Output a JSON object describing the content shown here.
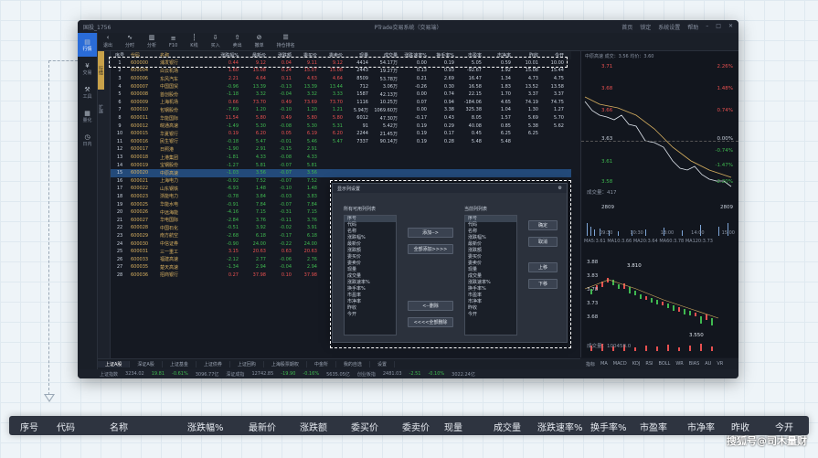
{
  "app": {
    "title": "PTrade交易系统（交易端）",
    "user": "国投_1756",
    "window_controls": [
      "首页",
      "锁定",
      "系统设置",
      "帮助"
    ]
  },
  "toolbar": {
    "items": [
      "退出",
      "分时",
      "分析",
      "F10",
      "K线",
      "买入",
      "卖出",
      "撤单",
      "持仓排名"
    ]
  },
  "leftnav": [
    "行情",
    "交易",
    "工具",
    "量化",
    "日内"
  ],
  "sidebar2": [
    "行情",
    "扩展"
  ],
  "grid": {
    "headers": [
      "序号",
      "代码",
      "名称",
      "涨跌幅%",
      "最新价",
      "涨跌额",
      "委买价",
      "委卖价",
      "现量",
      "成交量",
      "涨跌速率%",
      "换手率%",
      "市盈率",
      "市净率",
      "昨收",
      "今开"
    ],
    "rows": [
      [
        "1",
        "600000",
        "浦发银行",
        "0.44",
        "9.12",
        "0.04",
        "9.11",
        "9.12",
        "4414",
        "54.17万",
        "0.00",
        "0.19",
        "5.05",
        "0.59",
        "10.01",
        "10.00"
      ],
      [
        "2",
        "600004",
        "白云机场",
        "1.60",
        "15.08",
        "0.24",
        "15.07",
        "15.08",
        "2443",
        "19.27万",
        "0.13",
        "0.93",
        "-92.67",
        "1.92",
        "15.08",
        "15.44"
      ],
      [
        "3",
        "600006",
        "东风汽车",
        "2.21",
        "4.64",
        "0.11",
        "4.63",
        "4.64",
        "8509",
        "53.78万",
        "0.21",
        "2.69",
        "16.47",
        "1.34",
        "4.73",
        "4.75"
      ],
      [
        "4",
        "600007",
        "中国国贸",
        "-0.96",
        "13.39",
        "-0.13",
        "13.39",
        "13.44",
        "712",
        "3.06万",
        "-0.26",
        "0.30",
        "16.58",
        "1.83",
        "13.52",
        "13.58"
      ],
      [
        "5",
        "600008",
        "首创股份",
        "-1.18",
        "3.32",
        "-0.04",
        "3.32",
        "3.33",
        "1587",
        "42.13万",
        "0.00",
        "0.74",
        "22.15",
        "1.70",
        "3.37",
        "3.37"
      ],
      [
        "6",
        "600009",
        "上海机场",
        "0.66",
        "73.70",
        "0.49",
        "73.69",
        "73.70",
        "1116",
        "10.25万",
        "0.07",
        "0.94",
        "-184.06",
        "4.65",
        "74.19",
        "74.75"
      ],
      [
        "7",
        "600010",
        "包钢股份",
        "-7.69",
        "1.20",
        "-0.10",
        "1.20",
        "1.21",
        "5.94万",
        "1069.60万",
        "0.00",
        "3.38",
        "325.38",
        "1.04",
        "1.30",
        "1.27"
      ],
      [
        "8",
        "600011",
        "华能国际",
        "11.54",
        "5.80",
        "0.49",
        "5.80",
        "5.80",
        "6012",
        "47.30万",
        "-0.17",
        "0.43",
        "8.05",
        "1.57",
        "5.69",
        "5.70"
      ],
      [
        "9",
        "600012",
        "皖通高速",
        "-1.49",
        "5.30",
        "-0.08",
        "5.30",
        "5.31",
        "91",
        "5.42万",
        "0.19",
        "0.29",
        "40.08",
        "0.85",
        "5.38",
        "5.62"
      ],
      [
        "10",
        "600015",
        "华夏银行",
        "0.19",
        "6.20",
        "0.05",
        "6.19",
        "6.20",
        "2244",
        "21.45万",
        "0.19",
        "0.17",
        "0.45",
        "6.25",
        "6.25"
      ],
      [
        "11",
        "600016",
        "民生银行",
        "-0.18",
        "5.47",
        "-0.01",
        "5.46",
        "5.47",
        "7337",
        "90.14万",
        "0.19",
        "0.28",
        "5.48",
        "5.48"
      ],
      [
        "12",
        "600017",
        "日照港",
        "-1.90",
        "2.91",
        "-0.15",
        "2.91",
        "",
        "",
        "",
        "",
        "",
        "",
        "",
        "",
        ""
      ],
      [
        "13",
        "600018",
        "上港集团",
        "-1.81",
        "4.33",
        "-0.08",
        "4.33",
        "",
        "",
        "",
        "",
        "",
        "",
        "",
        "",
        ""
      ],
      [
        "14",
        "600019",
        "宝钢股份",
        "-1.27",
        "5.81",
        "-0.07",
        "5.81",
        "",
        "",
        "",
        "",
        "",
        "",
        "",
        "",
        ""
      ],
      [
        "15",
        "600020",
        "中原高速",
        "-1.03",
        "3.56",
        "-0.07",
        "3.56",
        "",
        "",
        "",
        "",
        "",
        "",
        "",
        "",
        ""
      ],
      [
        "16",
        "600021",
        "上海电力",
        "-0.92",
        "7.52",
        "-0.07",
        "7.52",
        "",
        "",
        "",
        "",
        "",
        "",
        "",
        "",
        ""
      ],
      [
        "17",
        "600022",
        "山东钢铁",
        "-6.93",
        "1.48",
        "-0.10",
        "1.48",
        "",
        "",
        "",
        "",
        "",
        "",
        "",
        "",
        ""
      ],
      [
        "18",
        "600023",
        "浙能电力",
        "-0.78",
        "3.84",
        "-0.03",
        "3.83",
        "",
        "",
        "",
        "",
        "",
        "",
        "",
        "",
        ""
      ],
      [
        "19",
        "600025",
        "华能水电",
        "-0.91",
        "7.84",
        "-0.07",
        "7.84",
        "",
        "",
        "",
        "",
        "",
        "",
        "",
        "",
        ""
      ],
      [
        "20",
        "600026",
        "中远海能",
        "-4.16",
        "7.15",
        "-0.31",
        "7.15",
        "",
        "",
        "",
        "",
        "",
        "",
        "",
        "",
        ""
      ],
      [
        "21",
        "600027",
        "华电国际",
        "-2.84",
        "3.76",
        "-0.11",
        "3.76",
        "",
        "",
        "",
        "",
        "",
        "",
        "",
        "",
        ""
      ],
      [
        "22",
        "600028",
        "中国石化",
        "-0.51",
        "3.92",
        "-0.02",
        "3.91",
        "",
        "",
        "",
        "",
        "",
        "",
        "",
        "",
        ""
      ],
      [
        "23",
        "600029",
        "南方航空",
        "-2.68",
        "6.18",
        "-0.17",
        "6.18",
        "",
        "",
        "",
        "",
        "",
        "",
        "",
        "",
        ""
      ],
      [
        "24",
        "600030",
        "中信证券",
        "-0.90",
        "24.00",
        "-0.22",
        "24.00",
        "",
        "",
        "",
        "",
        "",
        "",
        "",
        "",
        ""
      ],
      [
        "25",
        "600031",
        "三一重工",
        "3.15",
        "20.63",
        "0.63",
        "20.63",
        "",
        "",
        "",
        "",
        "",
        "",
        "",
        "",
        ""
      ],
      [
        "26",
        "600033",
        "福建高速",
        "-2.12",
        "2.77",
        "-0.06",
        "2.76",
        "",
        "",
        "",
        "",
        "",
        "",
        "",
        "",
        ""
      ],
      [
        "27",
        "600035",
        "楚天高速",
        "-1.34",
        "2.94",
        "-0.04",
        "2.94",
        "",
        "",
        "",
        "",
        "",
        "",
        "",
        "",
        ""
      ],
      [
        "28",
        "600036",
        "招商银行",
        "0.27",
        "37.98",
        "0.10",
        "37.98",
        "",
        "",
        "",
        "",
        "",
        "",
        "",
        "",
        ""
      ]
    ]
  },
  "dialog": {
    "title": "显示列设置",
    "available_label": "所有可用列列表",
    "current_label": "当前列列表",
    "available": [
      "序号",
      "代码",
      "名称",
      "涨跌幅%",
      "最新价",
      "涨跌额",
      "委买价",
      "委卖价",
      "现量",
      "成交量",
      "涨跌速率%",
      "换手率%",
      "市盈率",
      "市净率",
      "昨收",
      "今开"
    ],
    "current": [
      "序号",
      "代码",
      "名称",
      "涨跌幅%",
      "最新价",
      "涨跌额",
      "委买价",
      "委卖价",
      "现量",
      "成交量",
      "涨跌速率%",
      "换手率%",
      "市盈率",
      "市净率",
      "昨收",
      "今开"
    ],
    "buttons": {
      "add": "添加-->",
      "add_all": "全部添加>>>>",
      "remove": "<--删除",
      "remove_all": "<<<<全部删除",
      "ok": "确定",
      "cancel": "取消",
      "up": "上移",
      "down": "下移"
    }
  },
  "chart": {
    "header": "中原高速  成交：3.56  均价：3.60",
    "price_labels": [
      "3.71",
      "3.68",
      "3.66",
      "3.63",
      "3.61",
      "3.58",
      "3.55"
    ],
    "pct_labels": [
      "2.26%",
      "1.48%",
      "0.74%",
      "0.00%",
      "-0.74%",
      "-1.47%",
      "-2.20%"
    ],
    "volume_label": "成交量：417",
    "vol_values": [
      "2809",
      "2809"
    ],
    "time_labels": [
      "09:30",
      "10:30",
      "13:00",
      "14:00",
      "15:00"
    ],
    "ma_line": "MA5:3.61  MA10:3.66  MA20:3.64  MA60:3.78  MA120:3.73",
    "k_labels": [
      "3.88",
      "3.83",
      "3.78",
      "3.73",
      "3.68",
      "3.63",
      "3.58",
      "3.53"
    ],
    "k_high": "3.810",
    "k_low": "3.550",
    "k_vol_label": "成交量：100458.0",
    "k_vol_values": [
      "8.2万",
      "8.2万"
    ],
    "k_dates": [
      "2020/07/28",
      "2020/08/25"
    ],
    "indicator_tabs": [
      "指标",
      "MA",
      "MACD",
      "KDJ",
      "RSI",
      "BOLL",
      "WR",
      "BIAS",
      "AU",
      "VR"
    ]
  },
  "tabsbar": [
    "上证A股",
    "深证A股",
    "上证基金",
    "上证债券",
    "上证回购",
    "上海股票期权",
    "中金所",
    "我的自选",
    "设置"
  ],
  "statusbar": [
    "上证指数",
    "3234.02",
    "19.81",
    "-0.61%",
    "3096.77亿",
    "深证成指",
    "12742.85",
    "-19.90",
    "-0.16%",
    "5635.05亿",
    "创业板指",
    "2481.03",
    "-2.51",
    "-0.10%",
    "3022.24亿"
  ],
  "bottom_headers": [
    "序号",
    "代码",
    "名称",
    "涨跌幅%",
    "最新价",
    "涨跌额",
    "委买价",
    "委卖价",
    "现量",
    "成交量",
    "涨跌速率%",
    "换手率%",
    "市盈率",
    "市净率",
    "昨收",
    "今开"
  ],
  "watermark": "搜狐号@司木量财",
  "colors": {
    "up": "#e85050",
    "down": "#3fb950",
    "accent": "#2a6cd8",
    "background": "#151922"
  }
}
